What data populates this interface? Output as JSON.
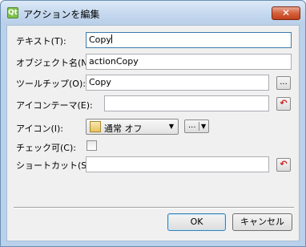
{
  "window": {
    "app_icon_label": "Qt",
    "title": "アクションを編集",
    "close_label": "✕"
  },
  "form": {
    "text": {
      "label": "テキスト(T):",
      "value": "Copy"
    },
    "object_name": {
      "label": "オブジェクト名(N):",
      "value": "actionCopy"
    },
    "tooltip": {
      "label": "ツールチップ(O):",
      "value": "Copy",
      "browse_label": "..."
    },
    "icon_theme": {
      "label": "アイコンテーマ(E):",
      "value": "",
      "reset_label": "↶"
    },
    "icon": {
      "label": "アイコン(I):",
      "mode_value": "通常 オフ",
      "mode_arrow": "▼",
      "browse_label": "...",
      "browse_arrow": "▼"
    },
    "checkable": {
      "label": "チェック可(C):",
      "checked": false
    },
    "shortcut": {
      "label": "ショートカット(S):",
      "value": "",
      "reset_label": "↶"
    }
  },
  "buttons": {
    "ok": "OK",
    "cancel": "キャンセル"
  }
}
